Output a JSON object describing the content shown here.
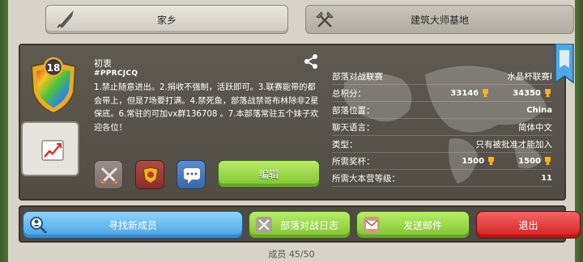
{
  "tabs": {
    "home_label": "家乡",
    "builder_label": "建筑大师基地"
  },
  "clan": {
    "level": "18",
    "name": "初衷",
    "tag": "#PPRCJCQ",
    "description": "1.禁止随意进出。2.捐收不强制，活跃即可。3.联赛能带的都会带上，但是7场要打满。4.禁死鱼，部落战禁哥布林除非2星保底。6.常驻的可加vx群136708  。7.本部落常驻五个妹子欢迎各位！"
  },
  "info": {
    "league_label": "部落对战联赛",
    "league_value": "水晶杯联赛I",
    "points_label": "总积分：",
    "points_home": "33146",
    "points_builder": "34350",
    "location_label": "部落位置：",
    "location_value": "China",
    "chat_label": "聊天语言：",
    "chat_value": "简体中文",
    "type_label": "类型：",
    "type_value": "只有被批准才能加入",
    "trophies_label": "所需奖杯：",
    "trophies_home": "1500",
    "trophies_builder": "1500",
    "townhall_label": "所需大本营等级：",
    "townhall_value": "11"
  },
  "actions": {
    "edit_label": "编辑",
    "find_members_label": "寻找新成员",
    "war_log_label": "部落对战日志",
    "send_mail_label": "发送邮件",
    "leave_label": "退出"
  },
  "footer": {
    "members_text": "成员 45/50"
  },
  "colors": {
    "panel": "#5a554c",
    "green_button": "#8fd13a",
    "blue_button": "#5ab4f0",
    "red_button": "#e63c3c",
    "trophy_gold": "#f2b51c"
  },
  "icons": {
    "home_tab": "sword-icon",
    "builder_tab": "crossed-axes-icon",
    "share": "share-icon",
    "war": "crossed-swords-icon",
    "rank": "medal-icon",
    "chat": "chat-bubble-icon",
    "find": "search-person-icon",
    "war_log": "war-log-icon",
    "mail": "mail-icon",
    "stats": "chart-icon"
  }
}
